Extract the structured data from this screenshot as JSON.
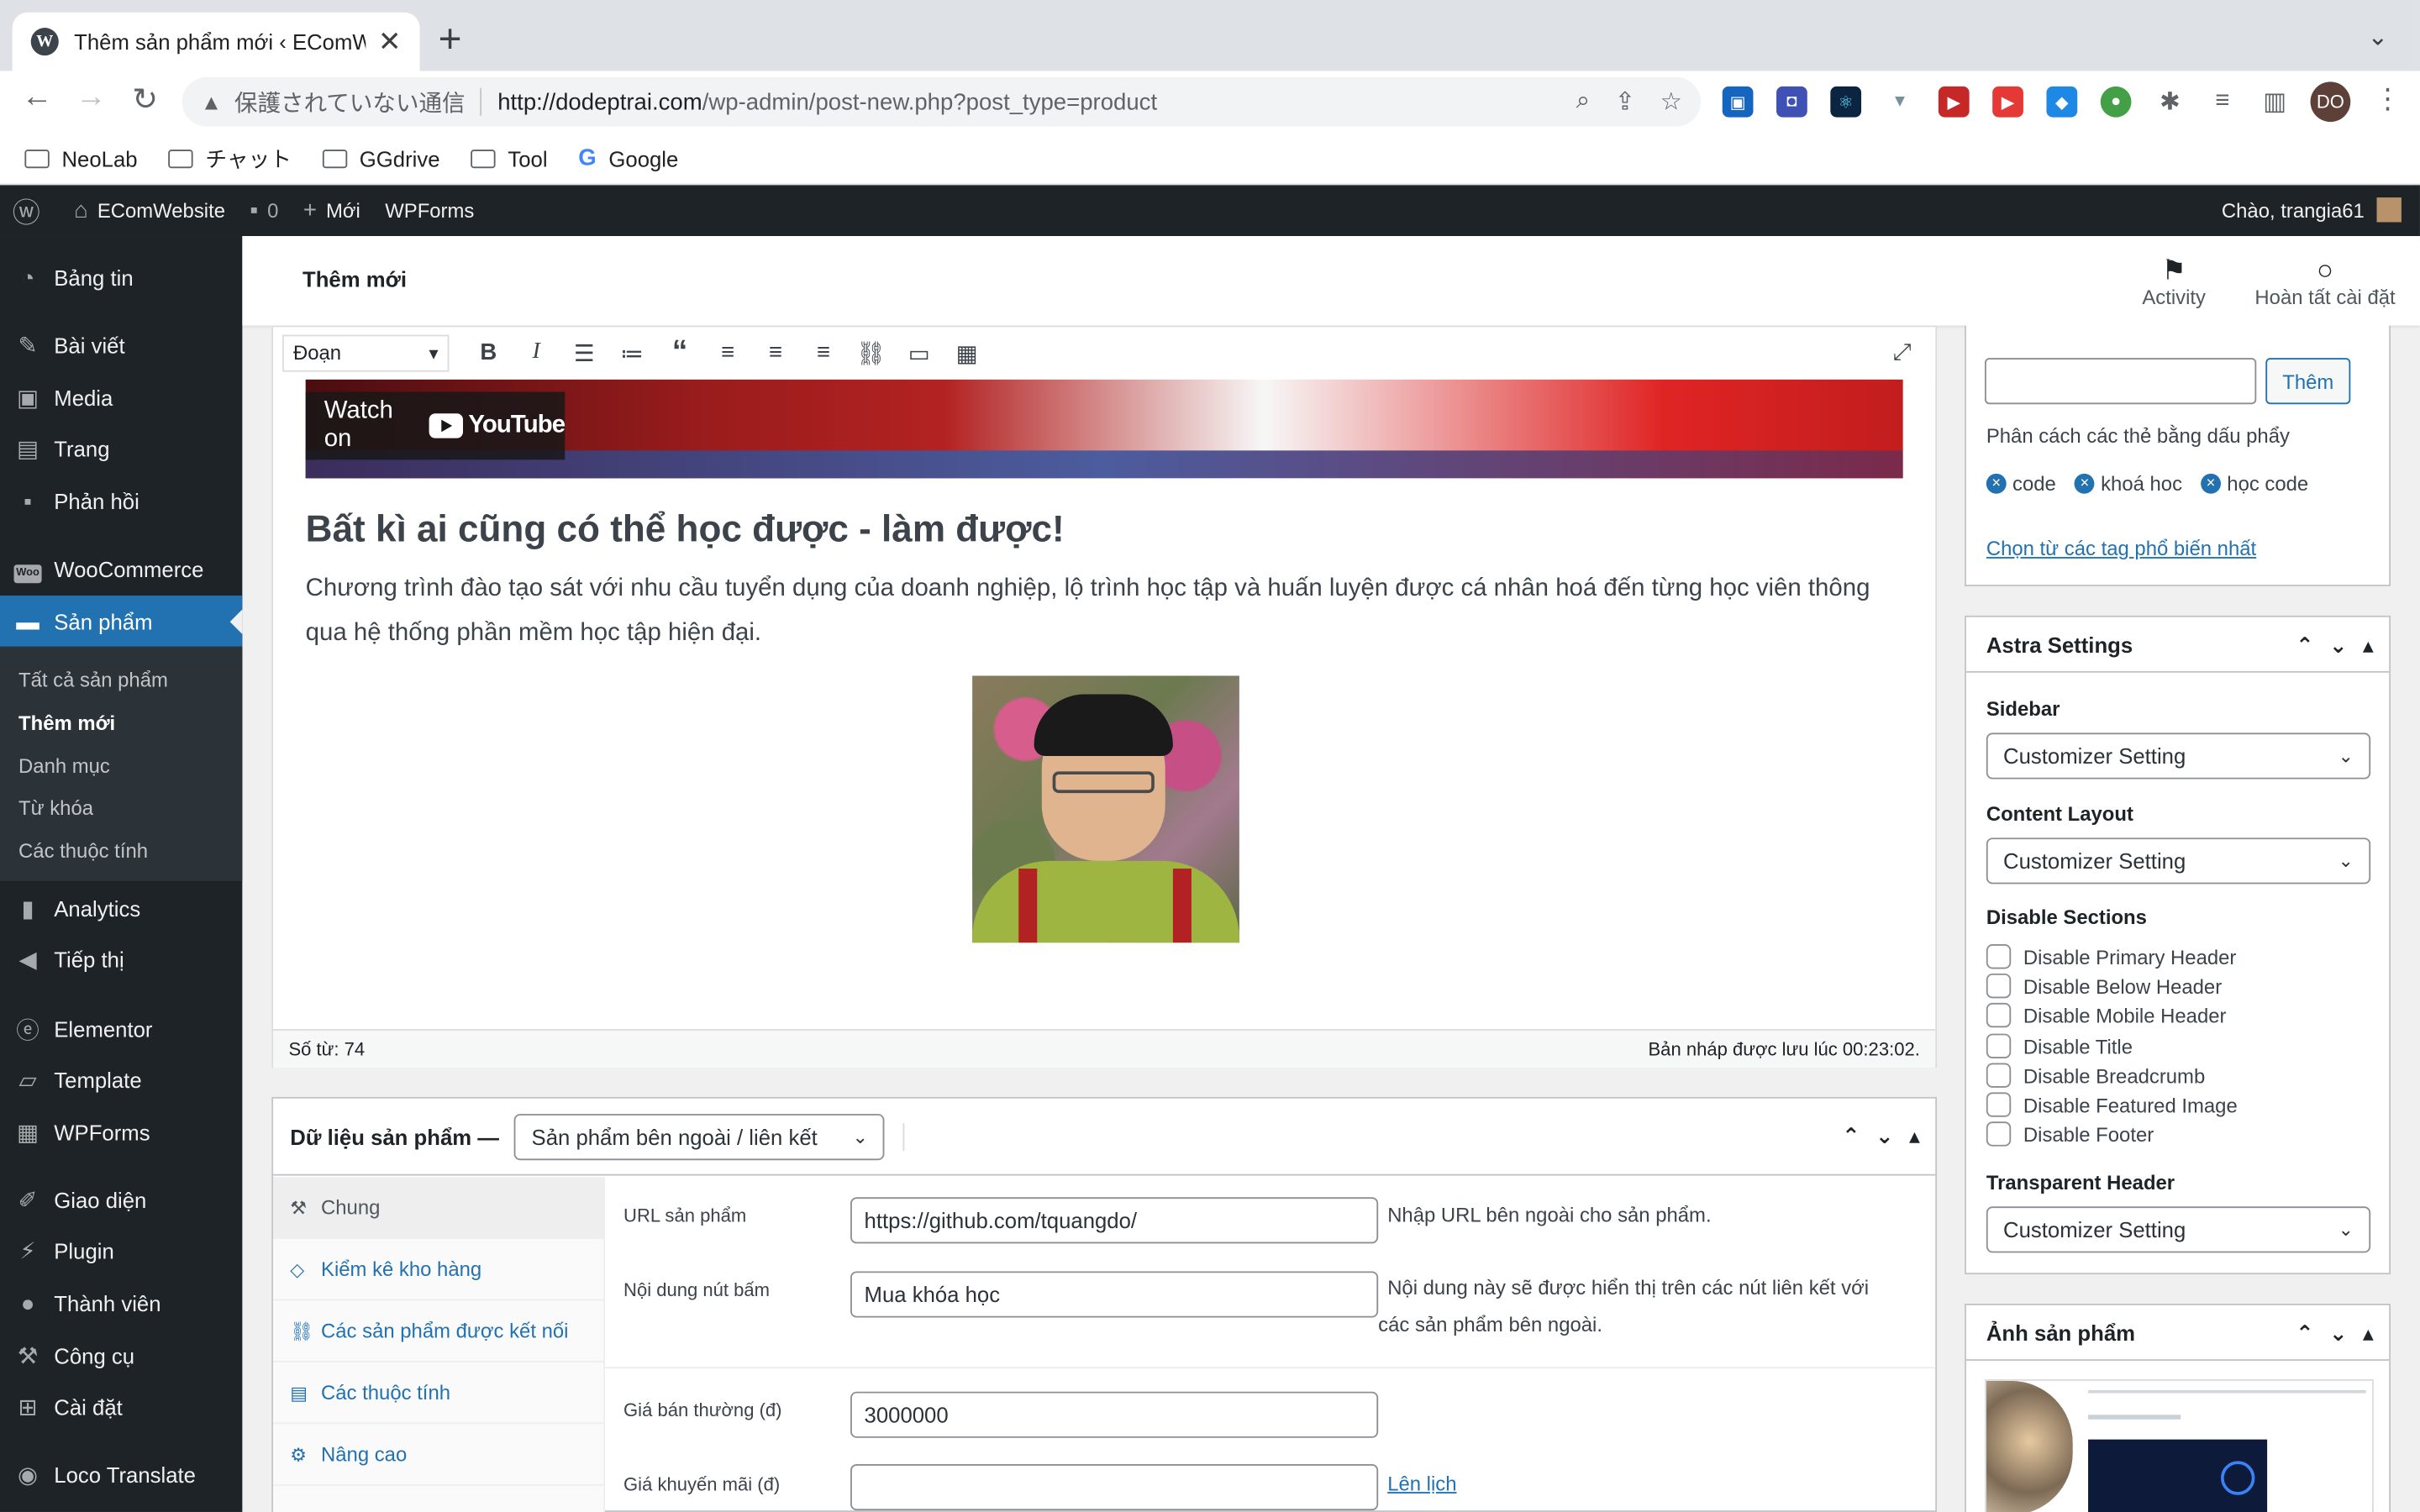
{
  "browser": {
    "tab_title": "Thêm sản phẩm mới ‹ EComWebsite",
    "security_label": "保護されていない通信",
    "url_host": "http://dodeptrai.com",
    "url_path": "/wp-admin/post-new.php?post_type=product",
    "profile": "DO",
    "bookmarks": [
      "NeoLab",
      "チャット",
      "GGdrive",
      "Tool",
      "Google"
    ]
  },
  "adminbar": {
    "site": "EComWebsite",
    "comments": "0",
    "new": "Mới",
    "wpforms": "WPForms",
    "howdy": "Chào, trangia61"
  },
  "sidebar": {
    "items": [
      "Bảng tin",
      "Bài viết",
      "Media",
      "Trang",
      "Phản hồi",
      "WooCommerce",
      "Sản phẩm",
      "Analytics",
      "Tiếp thị",
      "Elementor",
      "Template",
      "WPForms",
      "Giao diện",
      "Plugin",
      "Thành viên",
      "Công cụ",
      "Cài đặt",
      "Loco Translate"
    ],
    "sub": [
      "Tất cả sản phẩm",
      "Thêm mới",
      "Danh mục",
      "Từ khóa",
      "Các thuộc tính"
    ]
  },
  "header": {
    "title": "Thêm mới",
    "activity": "Activity",
    "finish": "Hoàn tất cài đặt"
  },
  "editor": {
    "format": "Đoạn",
    "watch_on": "Watch on",
    "youtube": "YouTube",
    "heading": "Bất kì ai cũng có thể học được - làm được!",
    "paragraph": "Chương trình đào tạo sát với nhu cầu tuyển dụng của doanh nghiệp, lộ trình học tập và huấn luyện được cá nhân hoá đến từng học viên thông qua hệ thống phần mềm học tập hiện đại.",
    "word_count": "Số từ: 74",
    "saved": "Bản nháp được lưu lúc 00:23:02."
  },
  "product": {
    "title": "Dữ liệu sản phẩm —",
    "type": "Sản phẩm bên ngoài / liên kết",
    "tabs": [
      "Chung",
      "Kiểm kê kho hàng",
      "Các sản phẩm được kết nối",
      "Các thuộc tính",
      "Nâng cao"
    ],
    "url_label": "URL sản phẩm",
    "url_value": "https://github.com/tquangdo/",
    "url_hint": "Nhập URL bên ngoài cho sản phẩm.",
    "btn_label": "Nội dung nút bấm",
    "btn_value": "Mua khóa học",
    "btn_hint": "Nội dung này sẽ được hiển thị trên các nút liên kết với các sản phẩm bên ngoài.",
    "price_label": "Giá bán thường (đ)",
    "price_value": "3000000",
    "sale_label": "Giá khuyến mãi (đ)",
    "sale_value": "",
    "schedule": "Lên lịch"
  },
  "tags": {
    "add": "Thêm",
    "hint": "Phân cách các thẻ bằng dấu phẩy",
    "items": [
      "code",
      "khoá hoc",
      "học code"
    ],
    "popular": "Chọn từ các tag phổ biến nhất"
  },
  "astra": {
    "title": "Astra Settings",
    "sidebar_label": "Sidebar",
    "sidebar_value": "Customizer Setting",
    "layout_label": "Content Layout",
    "layout_value": "Customizer Setting",
    "disable_label": "Disable Sections",
    "disable": [
      "Disable Primary Header",
      "Disable Below Header",
      "Disable Mobile Header",
      "Disable Title",
      "Disable Breadcrumb",
      "Disable Featured Image",
      "Disable Footer"
    ],
    "transparent_label": "Transparent Header",
    "transparent_value": "Customizer Setting"
  },
  "image_box": {
    "title": "Ảnh sản phẩm"
  }
}
